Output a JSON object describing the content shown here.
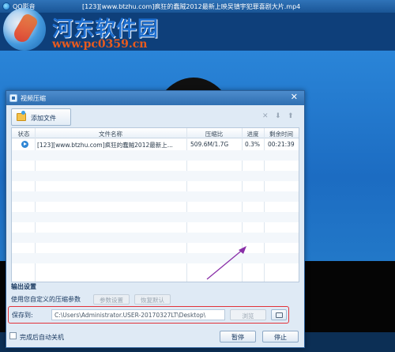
{
  "player": {
    "app_name": "QQ影音",
    "file_title": "[123][www.btzhu.com]疯狂的蠢贼2012最新上映吴镇宇犯罪喜剧大片.mp4"
  },
  "watermark": {
    "site_name": "河东软件园",
    "url": "www.pc0359.cn"
  },
  "dialog": {
    "title": "视频压缩",
    "add_file_label": "添加文件",
    "toolbar_icons": [
      "delete-icon",
      "move-down-icon",
      "move-up-icon"
    ],
    "table": {
      "columns": [
        "状态",
        "文件名称",
        "压缩比",
        "进度",
        "剩余时间"
      ],
      "rows": [
        {
          "status_icon": "play-circle-icon",
          "file_name": "[123][www.btzhu.com]疯狂的蠢贼2012最新上...",
          "ratio": "509.6M/1.7G",
          "progress": "0.3%",
          "remaining": "00:21:39"
        }
      ]
    },
    "output": {
      "title": "输出设置",
      "param_label": "使用您自定义的压缩参数",
      "param_settings_button": "参数设置",
      "restore_default_button": "恢复默认",
      "save_label": "保存到:",
      "save_path": "C:\\Users\\Administrator.USER-20170327LT\\Desktop\\",
      "browse_button": "浏览"
    },
    "shutdown_label": "完成后自动关机",
    "pause_button": "暂停",
    "stop_button": "停止"
  },
  "colors": {
    "title_bar": "#2f6fb1",
    "dialog_bg": "#dfeaf5",
    "highlight_border": "#e2333a",
    "annotation_arrow": "#8a2fa8"
  }
}
